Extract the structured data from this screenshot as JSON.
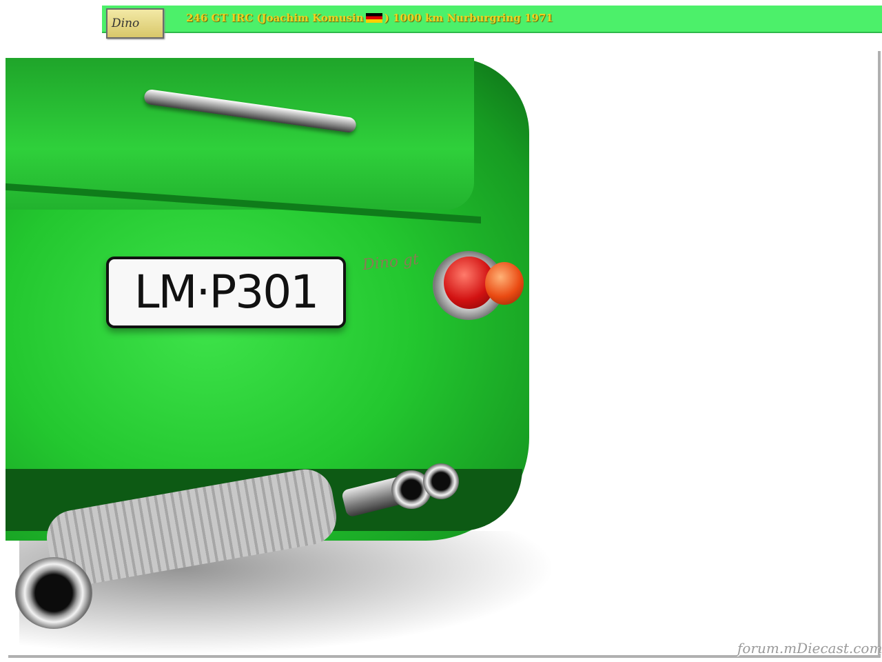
{
  "banner": {
    "logo_text": "Dino",
    "title_part1": "246 GT  IRC (Joachim Komusin",
    "title_part2": ") 1000 km Nurburgring 1971"
  },
  "photo": {
    "plate_text": "LM·P301",
    "badge_text": "Dino gt"
  },
  "watermark": "forum.mDiecast.com",
  "colors": {
    "banner": "#4cf06a",
    "title": "#f0d020",
    "car_green": "#23c72f"
  }
}
